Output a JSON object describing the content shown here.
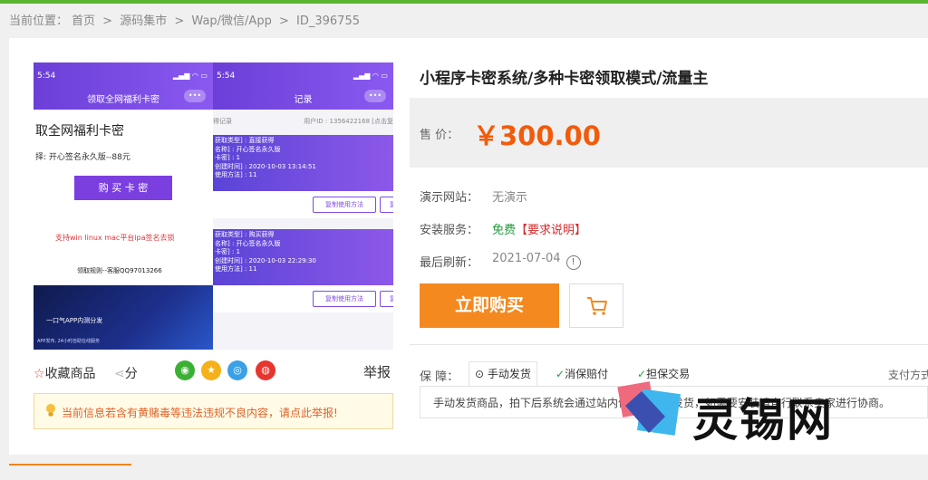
{
  "breadcrumb": {
    "label": "当前位置：",
    "items": [
      "首页",
      "源码集市",
      "Wap/微信/App",
      "ID_396755"
    ],
    "separator": ">"
  },
  "gallery": {
    "left_phone": {
      "time": "5:54",
      "title": "领取全网福利卡密",
      "heading": "取全网福利卡密",
      "select_text": "择: 开心签名永久版--88元",
      "button": "购 买 卡 密",
      "note": "支持win linux mac平台ipa签名去锁",
      "rules": "领取规则--客服QQ97013266",
      "banner_title": "一口气APP内测分发",
      "banner_sub": "APP发布, 24小时自助在线服务"
    },
    "right_phone": {
      "time": "5:54",
      "title": "记录",
      "tab_left": "得记录",
      "tab_right": "用户ID : 1356422168 [点击复",
      "records": [
        {
          "lines": [
            "获取类型] : 直接获得",
            "名称] : 开心签名永久版",
            "卡密] : 1",
            "创建时间] : 2020-10-03 13:14:51",
            "使用方法] : 11"
          ],
          "btn1": "复制使用方法",
          "btn2": "复制卡密"
        },
        {
          "lines": [
            "获取类型] : 购买获得",
            "名称] : 开心签名永久版",
            "卡密] : 1",
            "创建时间] : 2020-10-03 22:29:30",
            "使用方法] : 11"
          ],
          "btn1": "复制使用方法",
          "btn2": "复制卡密"
        }
      ]
    }
  },
  "product": {
    "title": "小程序卡密系统/多种卡密领取模式/流量主",
    "price_label": "售  价：",
    "price": "￥300.00",
    "demo_label": "演示网站：",
    "demo_value": "无演示",
    "install_label": "安装服务：",
    "install_free": "免费",
    "install_req": "【要求说明】",
    "refresh_label": "最后刷新：",
    "refresh_value": "2021-07-04",
    "buy_button": "立即购买",
    "guarantee_label": "保  障：",
    "guarantees": [
      "手动发货",
      "消保赔付",
      "担保交易"
    ],
    "pay_label": "支付方式",
    "description": "手动发货商品，拍下后系统会通过站内信通知卖家发货，如需要安装请自行联系卖家进行协商。"
  },
  "actions": {
    "favorite": "收藏商品",
    "share": "分",
    "report": "举报"
  },
  "notice": "当前信息若含有黄赌毒等违法违规不良内容，请点此举报!",
  "watermark": "灵锡网",
  "colors": {
    "accent": "#f3891f",
    "price": "#f25b0b",
    "green_bar": "#5cb531",
    "wechat": "#3cb034",
    "qzone": "#f5b01a",
    "qq": "#3aa0e8",
    "weibo": "#e6362f"
  }
}
